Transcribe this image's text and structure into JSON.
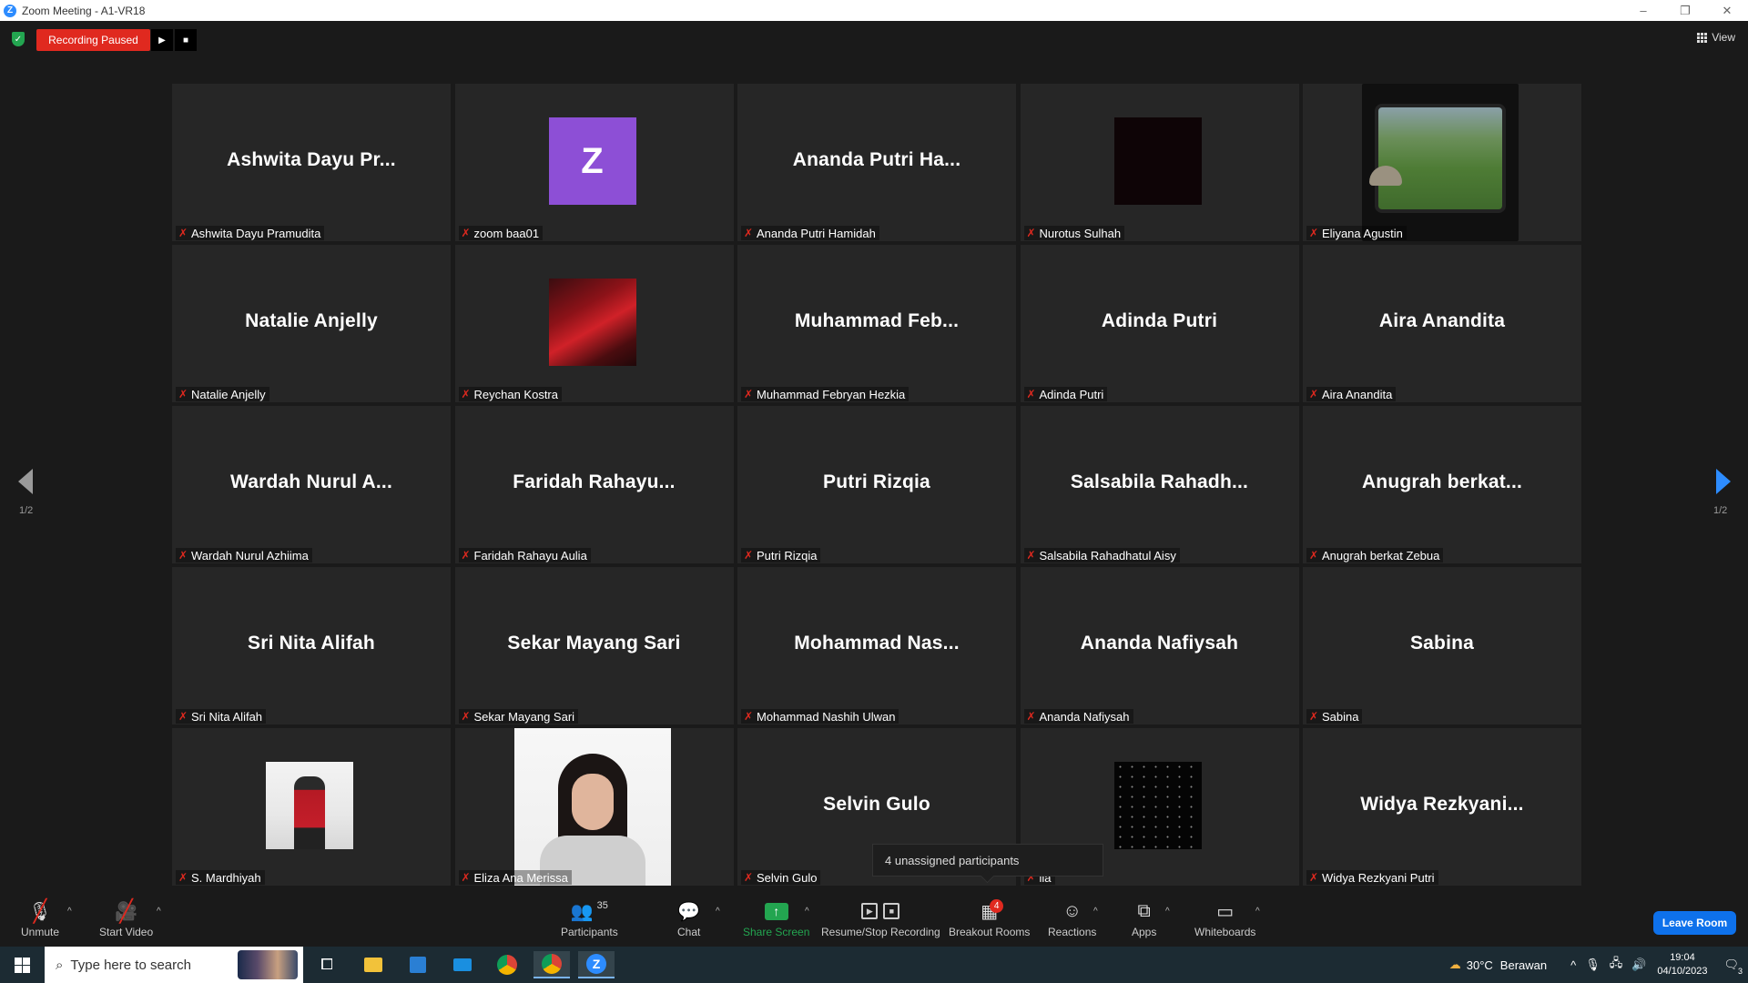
{
  "window": {
    "title": "Zoom Meeting - A1-VR18",
    "controls": [
      "–",
      "❐",
      "✕"
    ]
  },
  "topbar": {
    "recording_status": "Recording Paused",
    "view_label": "View"
  },
  "gallery": {
    "page_indicator_left": "1/2",
    "page_indicator_right": "1/2",
    "tiles": [
      {
        "display": "Ashwita Dayu Pr...",
        "name": "Ashwita Dayu Pramudita",
        "type": "text"
      },
      {
        "display": "Z",
        "name": "zoom baa01",
        "type": "letter"
      },
      {
        "display": "Ananda Putri Ha...",
        "name": "Ananda Putri Hamidah",
        "type": "text"
      },
      {
        "display": "",
        "name": "Nurotus Sulhah",
        "type": "dark"
      },
      {
        "display": "",
        "name": "Eliyana Agustin",
        "type": "video-window"
      },
      {
        "display": "Natalie Anjelly",
        "name": "Natalie Anjelly",
        "type": "text"
      },
      {
        "display": "",
        "name": "Reychan Kostra",
        "type": "red-photo"
      },
      {
        "display": "Muhammad Feb...",
        "name": "Muhammad Febryan Hezkia",
        "type": "text"
      },
      {
        "display": "Adinda Putri",
        "name": "Adinda Putri",
        "type": "text"
      },
      {
        "display": "Aira Anandita",
        "name": "Aira Anandita",
        "type": "text"
      },
      {
        "display": "Wardah Nurul A...",
        "name": "Wardah Nurul Azhiima",
        "type": "text"
      },
      {
        "display": "Faridah Rahayu...",
        "name": "Faridah Rahayu Aulia",
        "type": "text"
      },
      {
        "display": "Putri Rizqia",
        "name": "Putri Rizqia",
        "type": "text"
      },
      {
        "display": "Salsabila Rahadh...",
        "name": "Salsabila Rahadhatul Aisy",
        "type": "text"
      },
      {
        "display": "Anugrah berkat...",
        "name": "Anugrah berkat Zebua",
        "type": "text"
      },
      {
        "display": "Sri Nita Alifah",
        "name": "Sri Nita Alifah",
        "type": "text"
      },
      {
        "display": "Sekar Mayang Sari",
        "name": "Sekar Mayang Sari",
        "type": "text"
      },
      {
        "display": "Mohammad Nas...",
        "name": "Mohammad Nashih Ulwan",
        "type": "text"
      },
      {
        "display": "Ananda Nafiysah",
        "name": "Ananda Nafiysah",
        "type": "text"
      },
      {
        "display": "Sabina",
        "name": "Sabina",
        "type": "text"
      },
      {
        "display": "",
        "name": "S. Mardhiyah",
        "type": "photo"
      },
      {
        "display": "",
        "name": "Eliza Ana Merissa",
        "type": "video-girl"
      },
      {
        "display": "Selvin Gulo",
        "name": "Selvin Gulo",
        "type": "text"
      },
      {
        "display": "",
        "name": "ila",
        "type": "stars"
      },
      {
        "display": "Widya Rezkyani...",
        "name": "Widya Rezkyani Putri",
        "type": "text"
      }
    ]
  },
  "tooltip": {
    "text": "4 unassigned participants"
  },
  "toolbar": {
    "unmute": "Unmute",
    "start_video": "Start Video",
    "participants": "Participants",
    "participants_count": "35",
    "chat": "Chat",
    "share_screen": "Share Screen",
    "recording": "Resume/Stop Recording",
    "breakout": "Breakout Rooms",
    "breakout_badge": "4",
    "reactions": "Reactions",
    "apps": "Apps",
    "whiteboards": "Whiteboards",
    "leave": "Leave Room"
  },
  "taskbar": {
    "search_placeholder": "Type here to search",
    "weather_temp": "30°C",
    "weather_desc": "Berawan",
    "time": "19:04",
    "date": "04/10/2023",
    "notification_count": "3"
  },
  "colors": {
    "recording_red": "#e0291f",
    "leave_blue": "#0e71eb",
    "share_green": "#23a550",
    "zoom_blue": "#2d8cff"
  }
}
